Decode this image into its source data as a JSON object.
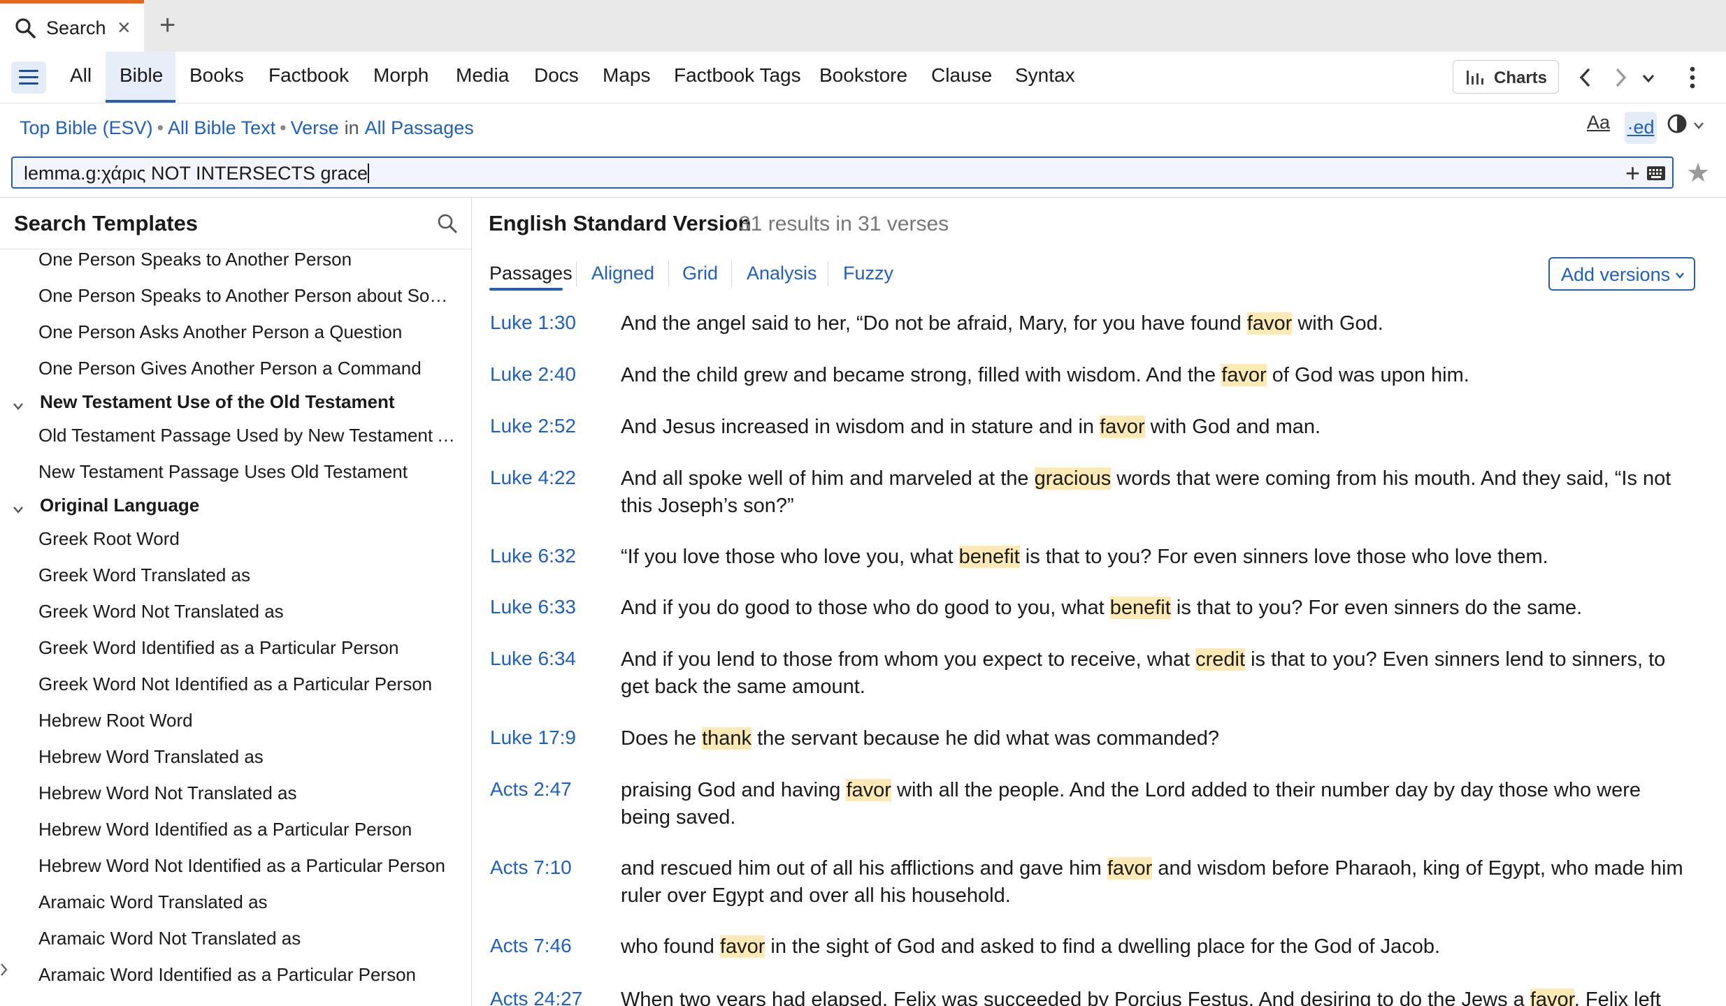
{
  "tab": {
    "label": "Search",
    "close": "×",
    "new_tab": "+"
  },
  "nav": {
    "items": [
      "All",
      "Bible",
      "Books",
      "Factbook",
      "Morph",
      "Media",
      "Docs",
      "Maps",
      "Factbook Tags",
      "Bookstore",
      "Clause",
      "Syntax"
    ],
    "active": "Bible",
    "charts_label": "Charts"
  },
  "scope": {
    "bible": "Top Bible (ESV)",
    "text": "All Bible Text",
    "unit": "Verse",
    "in_word": "in",
    "range": "All Passages",
    "font_btn": "Aa",
    "ed_btn": "·ed"
  },
  "search": {
    "query": "lemma.g:χάρις NOT INTERSECTS grace"
  },
  "left_panel": {
    "title": "Search Templates",
    "items": [
      {
        "label": "One Person Speaks to Another Person",
        "type": "item"
      },
      {
        "label": "One Person Speaks to Another Person about Someone",
        "type": "item"
      },
      {
        "label": "One Person Asks Another Person a Question",
        "type": "item"
      },
      {
        "label": "One Person Gives Another Person a Command",
        "type": "item"
      },
      {
        "label": "New Testament Use of the Old Testament",
        "type": "group"
      },
      {
        "label": "Old Testament Passage Used by New Testament Author",
        "type": "item"
      },
      {
        "label": "New Testament Passage Uses Old Testament",
        "type": "item"
      },
      {
        "label": "Original Language",
        "type": "group"
      },
      {
        "label": "Greek Root Word",
        "type": "item"
      },
      {
        "label": "Greek Word Translated as",
        "type": "item"
      },
      {
        "label": "Greek Word Not Translated as",
        "type": "item"
      },
      {
        "label": "Greek Word Identified as a Particular Person",
        "type": "item"
      },
      {
        "label": "Greek Word Not Identified as a Particular Person",
        "type": "item"
      },
      {
        "label": "Hebrew Root Word",
        "type": "item"
      },
      {
        "label": "Hebrew Word Translated as",
        "type": "item"
      },
      {
        "label": "Hebrew Word Not Translated as",
        "type": "item"
      },
      {
        "label": "Hebrew Word Identified as a Particular Person",
        "type": "item"
      },
      {
        "label": "Hebrew Word Not Identified as a Particular Person",
        "type": "item"
      },
      {
        "label": "Aramaic Word Translated as",
        "type": "item"
      },
      {
        "label": "Aramaic Word Not Translated as",
        "type": "item"
      },
      {
        "label": "Aramaic Word Identified as a Particular Person",
        "type": "item"
      }
    ]
  },
  "results": {
    "version": "English Standard Version",
    "count": "31 results in 31 verses",
    "tabs": [
      "Passages",
      "Aligned",
      "Grid",
      "Analysis",
      "Fuzzy"
    ],
    "active_tab": "Passages",
    "add_versions": "Add versions",
    "highlight_color": "#fde9b4",
    "rows": [
      {
        "ref": "Luke 1:30",
        "pre": "And the angel said to her, “Do not be afraid, Mary, for you have found ",
        "hit": "favor",
        "post": " with God."
      },
      {
        "ref": "Luke 2:40",
        "pre": "And the child grew and became strong, filled with wisdom. And the ",
        "hit": "favor",
        "post": " of God was upon him."
      },
      {
        "ref": "Luke 2:52",
        "pre": "And Jesus increased in wisdom and in stature and in ",
        "hit": "favor",
        "post": " with God and man."
      },
      {
        "ref": "Luke 4:22",
        "pre": "And all spoke well of him and marveled at the ",
        "hit": "gracious",
        "post": " words that were coming from his mouth. And they said, “Is not this Joseph’s son?”"
      },
      {
        "ref": "Luke 6:32",
        "pre": "“If you love those who love you, what ",
        "hit": "benefit",
        "post": " is that to you? For even sinners love those who love them."
      },
      {
        "ref": "Luke 6:33",
        "pre": "And if you do good to those who do good to you, what ",
        "hit": "benefit",
        "post": " is that to you? For even sinners do the same."
      },
      {
        "ref": "Luke 6:34",
        "pre": "And if you lend to those from whom you expect to receive, what ",
        "hit": "credit",
        "post": " is that to you? Even sinners lend to sinners, to get back the same amount."
      },
      {
        "ref": "Luke 17:9",
        "pre": "Does he ",
        "hit": "thank",
        "post": " the servant because he did what was commanded?"
      },
      {
        "ref": "Acts 2:47",
        "pre": "praising God and having ",
        "hit": "favor",
        "post": " with all the people. And the Lord added to their number day by day those who were being saved."
      },
      {
        "ref": "Acts 7:10",
        "pre": "and rescued him out of all his afflictions and gave him ",
        "hit": "favor",
        "post": " and wisdom before Pharaoh, king of Egypt, who made him ruler over Egypt and over all his household."
      },
      {
        "ref": "Acts 7:46",
        "pre": "who found ",
        "hit": "favor",
        "post": " in the sight of God and asked to find a dwelling place for the God of Jacob."
      },
      {
        "ref": "Acts 24:27",
        "pre": "When two years had elapsed, Felix was succeeded by Porcius Festus. And desiring to do the Jews a ",
        "hit": "favor",
        "post": ", Felix left Paul"
      }
    ]
  }
}
